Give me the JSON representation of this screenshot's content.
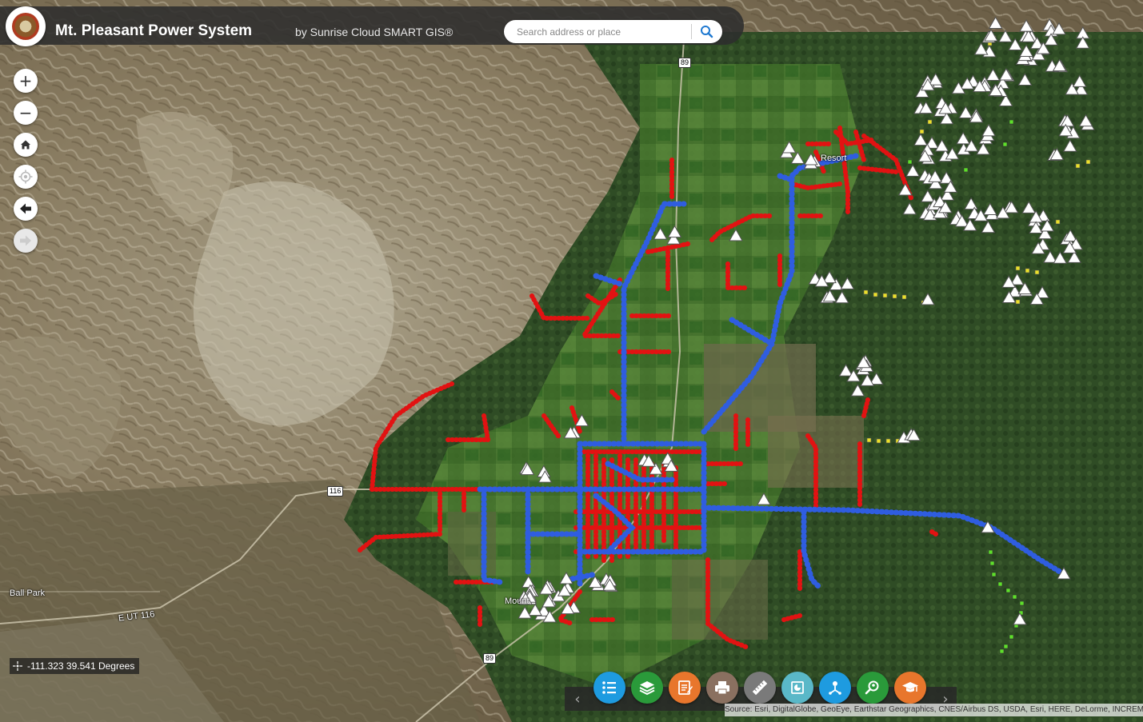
{
  "header": {
    "title": "Mt. Pleasant Power System",
    "subtitle": "by Sunrise Cloud SMART GIS®"
  },
  "search": {
    "placeholder": "Search address or place"
  },
  "nav": {
    "zoom_in": "+",
    "zoom_out": "−"
  },
  "coordinates": {
    "text": "-111.323 39.541 Degrees"
  },
  "map_labels": {
    "ball_park": "Ball Park",
    "road_e_ut_116": "E UT 116",
    "shield_116": "116",
    "shield_89_top": "89",
    "shield_89_bottom": "89",
    "town": "Mount",
    "resort": "Resort"
  },
  "toolbar": {
    "prev": "‹",
    "next": "›",
    "tools": [
      {
        "name": "legend",
        "color": "#1e9be0"
      },
      {
        "name": "layers",
        "color": "#2a9a3a"
      },
      {
        "name": "notes",
        "color": "#e8762c"
      },
      {
        "name": "print",
        "color": "#8a7060"
      },
      {
        "name": "measure",
        "color": "#7a7a7a"
      },
      {
        "name": "basemap",
        "color": "#5ab8c8"
      },
      {
        "name": "directions",
        "color": "#1e9be0"
      },
      {
        "name": "query",
        "color": "#2a9a3a"
      },
      {
        "name": "about",
        "color": "#e8762c"
      }
    ]
  },
  "attribution": {
    "text": "Source: Esri, DigitalGlobe, GeoEye, Earthstar Geographics, CNES/Airbus DS, USDA, Esri, HERE, DeLorme, INCREMENT P, USGS, Bureau"
  },
  "legend_colors": {
    "primary_lines": "#2f5de0",
    "secondary_lines": "#e21212",
    "transformers": "#ffffff",
    "yellow_points": "#ece12a",
    "green_points": "#5ee02a"
  }
}
